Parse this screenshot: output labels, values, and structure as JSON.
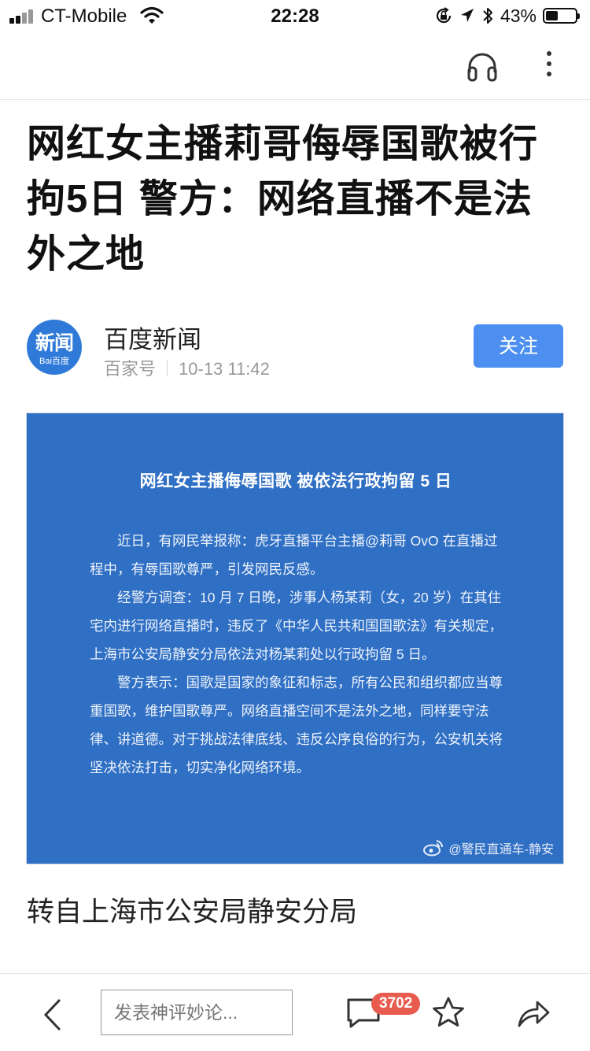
{
  "status_bar": {
    "carrier": "CT-Mobile",
    "time": "22:28",
    "battery_percent": "43%",
    "battery_level": 0.43,
    "icons": [
      "signal-icon",
      "wifi-icon",
      "orientation-lock-icon",
      "location-icon",
      "bluetooth-icon",
      "battery-icon"
    ]
  },
  "top_bar": {
    "icons": [
      "headphone-icon",
      "more-icon"
    ]
  },
  "article": {
    "title": "网红女主播莉哥侮辱国歌被行拘5日 警方：网络直播不是法外之地",
    "author": {
      "avatar_text": "新闻",
      "avatar_subtext": "Bai百度",
      "name": "百度新闻",
      "source_label": "百家号",
      "datetime": "10-13 11:42",
      "follow_label": "关注"
    },
    "notice_image": {
      "title": "网红女主播侮辱国歌   被依法行政拘留 5 日",
      "paragraphs": [
        "近日，有网民举报称：虎牙直播平台主播@莉哥 OvO 在直播过程中，有辱国歌尊严，引发网民反感。",
        "经警方调查：10 月 7 日晚，涉事人杨某莉（女，20 岁）在其住宅内进行网络直播时，违反了《中华人民共和国国歌法》有关规定，上海市公安局静安分局依法对杨某莉处以行政拘留 5 日。",
        "警方表示：国歌是国家的象征和标志，所有公民和组织都应当尊重国歌，维护国歌尊严。网络直播空间不是法外之地，同样要守法律、讲道德。对于挑战法律底线、违反公序良俗的行为，公安机关将坚决依法打击，切实净化网络环境。"
      ],
      "watermark": "@警民直通车-静安"
    },
    "source_text": "转自上海市公安局静安分局"
  },
  "bottom_bar": {
    "comment_placeholder": "发表神评妙论...",
    "comment_count": "3702",
    "icons": [
      "back-icon",
      "comment-icon",
      "star-icon",
      "share-icon"
    ]
  },
  "colors": {
    "accent_blue": "#4c8ff0",
    "notice_blue": "#2f6fc4",
    "badge_red": "#e85b4f"
  }
}
